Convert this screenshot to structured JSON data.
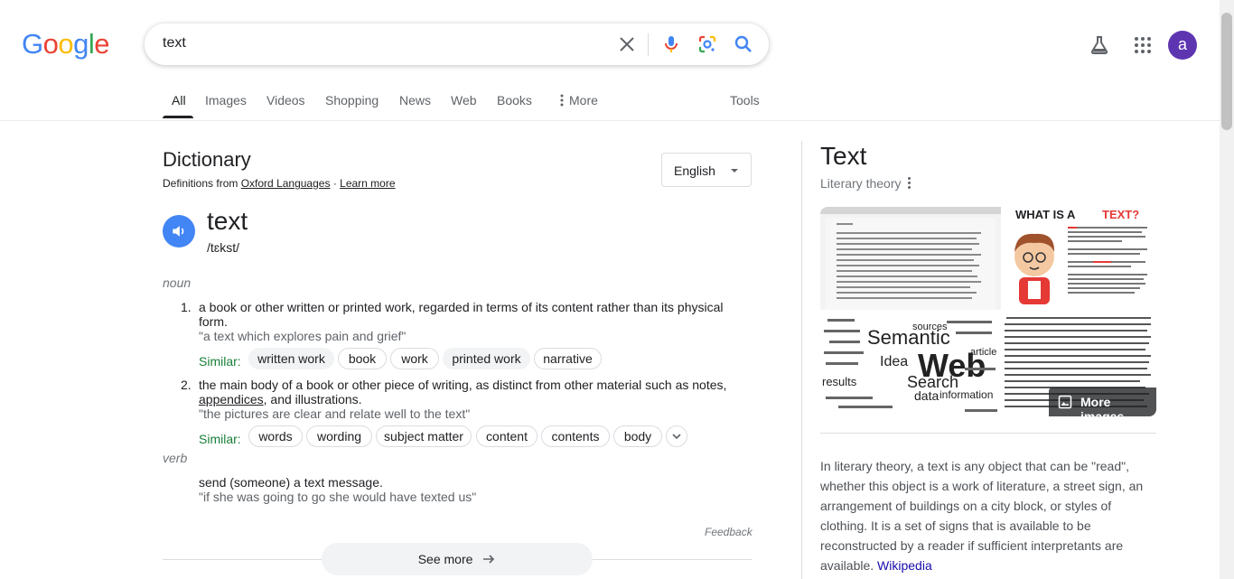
{
  "header": {
    "logo_letters": [
      {
        "ch": "G",
        "color": "#4285F4"
      },
      {
        "ch": "o",
        "color": "#EA4335"
      },
      {
        "ch": "o",
        "color": "#FBBC05"
      },
      {
        "ch": "g",
        "color": "#4285F4"
      },
      {
        "ch": "l",
        "color": "#34A853"
      },
      {
        "ch": "e",
        "color": "#EA4335"
      }
    ],
    "search_value": "text",
    "avatar_letter": "a",
    "icons": [
      "close-icon",
      "mic-icon",
      "lens-icon",
      "search-icon",
      "labs-flask-icon",
      "apps-grid-icon"
    ]
  },
  "tabs": [
    {
      "label": "All",
      "active": true
    },
    {
      "label": "Images"
    },
    {
      "label": "Videos"
    },
    {
      "label": "Shopping"
    },
    {
      "label": "News"
    },
    {
      "label": "Web"
    },
    {
      "label": "Books"
    },
    {
      "label": "More"
    },
    {
      "label": "Tools"
    }
  ],
  "dictionary": {
    "title": "Dictionary",
    "source_prefix": "Definitions from",
    "source_link": "Oxford Languages",
    "separator": "·",
    "learn_more": "Learn more",
    "language": "English",
    "word": "text",
    "phonetic": "/tɛkst/",
    "noun_label": "noun",
    "verb_label": "verb",
    "senses": [
      {
        "num": "1.",
        "definition": "a book or other written or printed work, regarded in terms of its content rather than its physical form.",
        "example": "\"a text which explores pain and grief\"",
        "similar_label": "Similar:",
        "similar": [
          "written work",
          "book",
          "work",
          "printed work",
          "narrative"
        ]
      },
      {
        "num": "2.",
        "definition_a": "the main body of a book or other piece of writing, as distinct from other material such as notes,",
        "definition_link": "appendices",
        "definition_b": ", and illustrations.",
        "example": "\"the pictures are clear and relate well to the text\"",
        "similar_label": "Similar:",
        "similar": [
          "words",
          "wording",
          "subject matter",
          "content",
          "contents",
          "body"
        ]
      }
    ],
    "verb_sense": {
      "definition": "send (someone) a text message.",
      "example": "\"if she was going to go she would have texted us\""
    },
    "feedback": "Feedback",
    "see_more": "See more"
  },
  "knowledge_panel": {
    "title": "Text",
    "subtitle": "Literary theory",
    "more_images": "More images",
    "image_texts": {
      "what_is_a": "WHAT IS A",
      "text_word": "TEXT?",
      "cloud_words": [
        "Semantic",
        "Web",
        "Search",
        "Idea",
        "data",
        "information",
        "results",
        "sources",
        "article"
      ]
    },
    "description": "In literary theory, a text is any object that can be \"read\", whether this object is a work of literature, a street sign, an arrangement of buildings on a city block, or styles of clothing. It is a set of signs that is available to be reconstructed by a reader if sufficient interpretants are available.",
    "wiki_link": "Wikipedia"
  },
  "colors": {
    "accent_blue": "#4285f4",
    "link_blue": "#1a0dab",
    "similar_green": "#188038",
    "avatar_purple": "#5e35b1",
    "text_red": "#e53935"
  }
}
